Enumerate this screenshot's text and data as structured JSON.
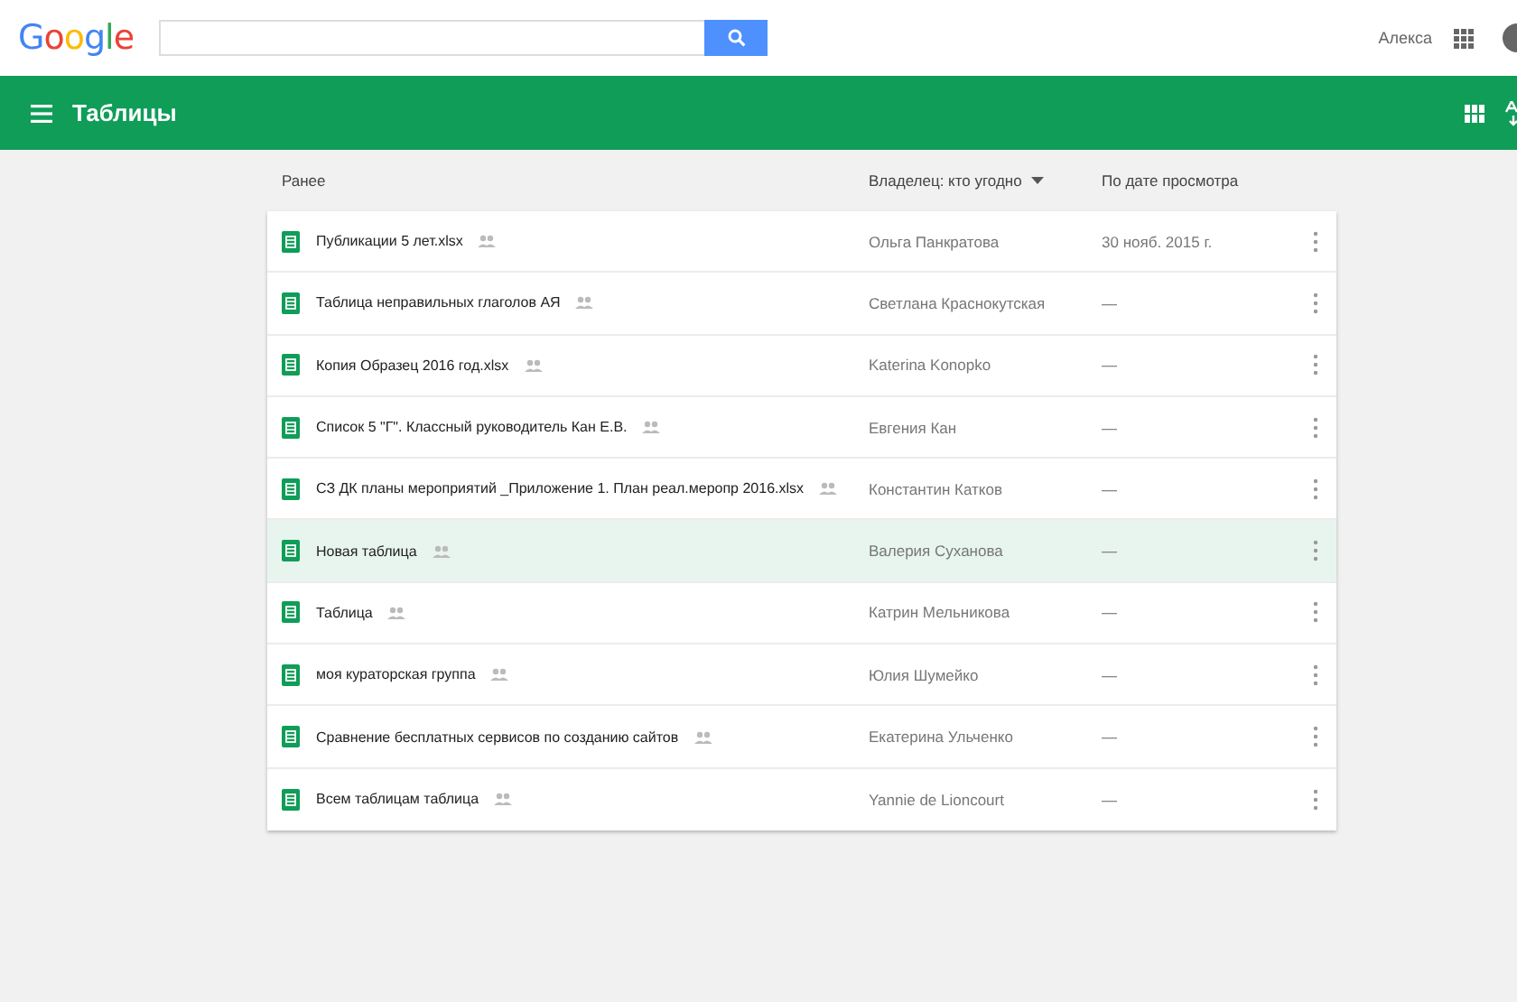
{
  "topbar": {
    "logo": "Google",
    "account_name": "Алекса"
  },
  "appbar": {
    "title": "Таблицы"
  },
  "list": {
    "columns": {
      "name": "Ранее",
      "owner": "Владелец: кто угодно",
      "date": "По дате просмотра"
    },
    "rows": [
      {
        "name": "Публикации 5 лет.xlsx",
        "shared": true,
        "owner": "Ольга Панкратова",
        "date": "30 нояб. 2015 г.",
        "selected": false
      },
      {
        "name": "Таблица неправильных глаголов АЯ",
        "shared": true,
        "owner": "Светлана Краснокутская",
        "date": "—",
        "selected": false
      },
      {
        "name": "Копия Образец 2016 год.xlsx",
        "shared": true,
        "owner": "Katerina Konopko",
        "date": "—",
        "selected": false
      },
      {
        "name": "Список 5 \"Г\". Классный руководитель Кан Е.В.",
        "shared": true,
        "owner": "Евгения Кан",
        "date": "—",
        "selected": false
      },
      {
        "name": "СЗ ДК планы мероприятий _Приложение 1. План реал.меропр 2016.xlsx",
        "shared": true,
        "owner": "Константин Катков",
        "date": "—",
        "selected": false
      },
      {
        "name": "Новая таблица",
        "shared": true,
        "owner": "Валерия Суханова",
        "date": "—",
        "selected": true
      },
      {
        "name": "Таблица",
        "shared": true,
        "owner": "Катрин Мельникова",
        "date": "—",
        "selected": false
      },
      {
        "name": "моя кураторская группа",
        "shared": true,
        "owner": "Юлия Шумейко",
        "date": "—",
        "selected": false
      },
      {
        "name": "Сравнение бесплатных сервисов по созданию сайтов",
        "shared": true,
        "owner": "Екатерина Ульченко",
        "date": "—",
        "selected": false
      },
      {
        "name": "Всем таблицам таблица",
        "shared": true,
        "owner": "Yannie de Lioncourt",
        "date": "—",
        "selected": false
      }
    ]
  }
}
